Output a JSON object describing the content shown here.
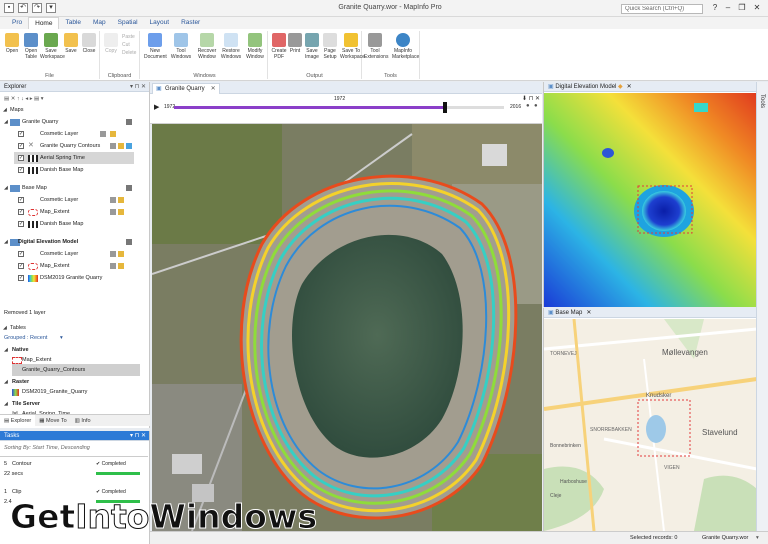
{
  "titlebar": {
    "app_title": "Granite Quarry.wor - MapInfo Pro",
    "search_placeholder": "Quick Search (Ctrl+Q)"
  },
  "ribbon_tabs": [
    "Pro",
    "Home",
    "Table",
    "Map",
    "Spatial",
    "Layout",
    "Raster"
  ],
  "ribbon": {
    "file_group": {
      "label": "File",
      "buttons": [
        "Open",
        "Open Table",
        "Save Workspace",
        "Save",
        "Close"
      ]
    },
    "clipboard_group": {
      "label": "Clipboard",
      "buttons": [
        "Copy",
        "Paste",
        "Cut",
        "Delete"
      ]
    },
    "windows_group": {
      "label": "Windows",
      "buttons": [
        "New Document",
        "Tool Windows",
        "Recover Window",
        "Restore Windows",
        "Modify Window"
      ]
    },
    "output_group": {
      "label": "Output",
      "buttons": [
        "Create PDF",
        "Print",
        "Save Image",
        "Page Setup",
        "Save To Workspace"
      ]
    },
    "tools_group": {
      "label": "Tools",
      "buttons": [
        "Tool Extensions",
        "MapInfo Marketplace"
      ]
    }
  },
  "explorer": {
    "title": "Explorer",
    "maps_label": "Maps",
    "groups": [
      {
        "name": "Granite Quarry",
        "layers": [
          "Cosmetic Layer",
          "Granite Quarry Contours",
          "Aerial Spring Time",
          "Danish Base Map"
        ]
      },
      {
        "name": "Base Map",
        "layers": [
          "Cosmetic Layer",
          "Map_Extent",
          "Danish Base Map"
        ]
      },
      {
        "name": "Digital Elevation Model",
        "layers": [
          "Cosmetic Layer",
          "Map_Extent",
          "DSM2019 Granite Quarry"
        ]
      }
    ],
    "removed_note": "Removed 1 layer",
    "tables_label": "Tables",
    "grouped_label": "Grouped : Recent",
    "table_groups": [
      {
        "name": "Native",
        "items": [
          "Map_Extent",
          "Granite_Quarry_Contours"
        ]
      },
      {
        "name": "Raster",
        "items": [
          "DSM2019_Granite_Quarry"
        ]
      },
      {
        "name": "Tile Server",
        "items": [
          "Aerial_Spring_Time"
        ]
      }
    ],
    "tabs": [
      "Explorer",
      "Move To",
      "Info"
    ]
  },
  "tasks": {
    "title": "Tasks",
    "sort_label": "Sorting By: Start Time, Descending",
    "items": [
      {
        "num": "5",
        "name": "Contour",
        "status": "Completed",
        "time": "22 secs"
      },
      {
        "num": "1",
        "name": "Clip",
        "status": "Completed",
        "time": "2.4"
      }
    ]
  },
  "main_map": {
    "tab_title": "Granite Quarry",
    "slider_start": "1972",
    "slider_current": "1972",
    "slider_end": "2016",
    "slider_progress": 0.82
  },
  "dem_pane": {
    "title": "Digital Elevation Model"
  },
  "base_pane": {
    "title": "Base Map",
    "place_labels": [
      "Møllevangen",
      "Knudsker",
      "Stavelund",
      "Bonnebrinken",
      "Harboshuse",
      "SNORREBAKKEN",
      "TORNEVEJ",
      "VIGEN",
      "Cleje"
    ]
  },
  "status_bar": {
    "selected": "Selected records: 0",
    "workspace": "Granite Quarry.wor"
  },
  "tools_strip": "Tools",
  "watermark": {
    "part1": "Get",
    "part2": "Into",
    "part3": "Windows"
  }
}
